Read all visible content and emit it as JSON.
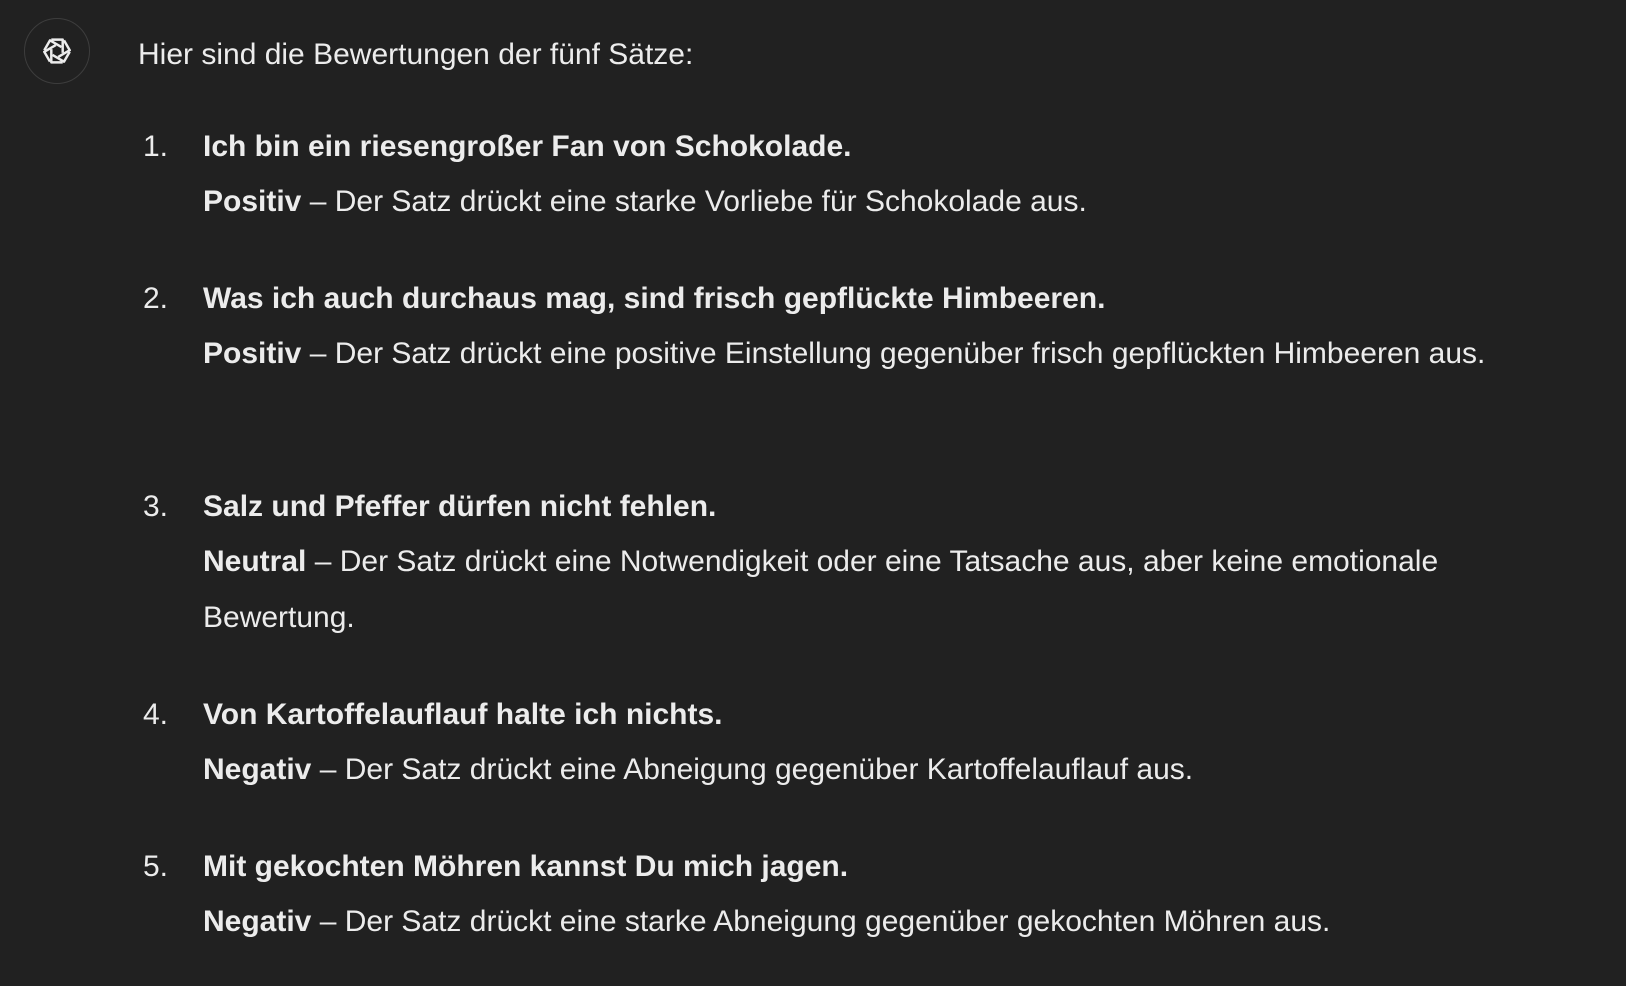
{
  "avatar": {
    "icon": "openai-logo-icon"
  },
  "message": {
    "intro": "Hier sind die Bewertungen der fünf Sätze:",
    "items": [
      {
        "number": "1.",
        "sentence": "Ich bin ein riesengroßer Fan von Schokolade.",
        "label": "Positiv",
        "explanation": " – Der Satz drückt eine starke Vorliebe für Schokolade aus."
      },
      {
        "number": "2.",
        "sentence": "Was ich auch durchaus mag, sind frisch gepflückte Himbeeren.",
        "label": "Positiv",
        "explanation": " – Der Satz drückt eine positive Einstellung gegenüber frisch gepflückten Himbeeren aus."
      },
      {
        "number": "3.",
        "sentence": "Salz und Pfeffer dürfen nicht fehlen.",
        "label": "Neutral",
        "explanation": " – Der Satz drückt eine Notwendigkeit oder eine Tatsache aus, aber keine emotionale Bewertung."
      },
      {
        "number": "4.",
        "sentence": "Von Kartoffelauflauf halte ich nichts.",
        "label": "Negativ",
        "explanation": " – Der Satz drückt eine Abneigung gegenüber Kartoffelauflauf aus."
      },
      {
        "number": "5.",
        "sentence": "Mit gekochten Möhren kannst Du mich jagen.",
        "label": "Negativ",
        "explanation": " – Der Satz drückt eine starke Abneigung gegenüber gekochten Möhren aus."
      }
    ]
  }
}
